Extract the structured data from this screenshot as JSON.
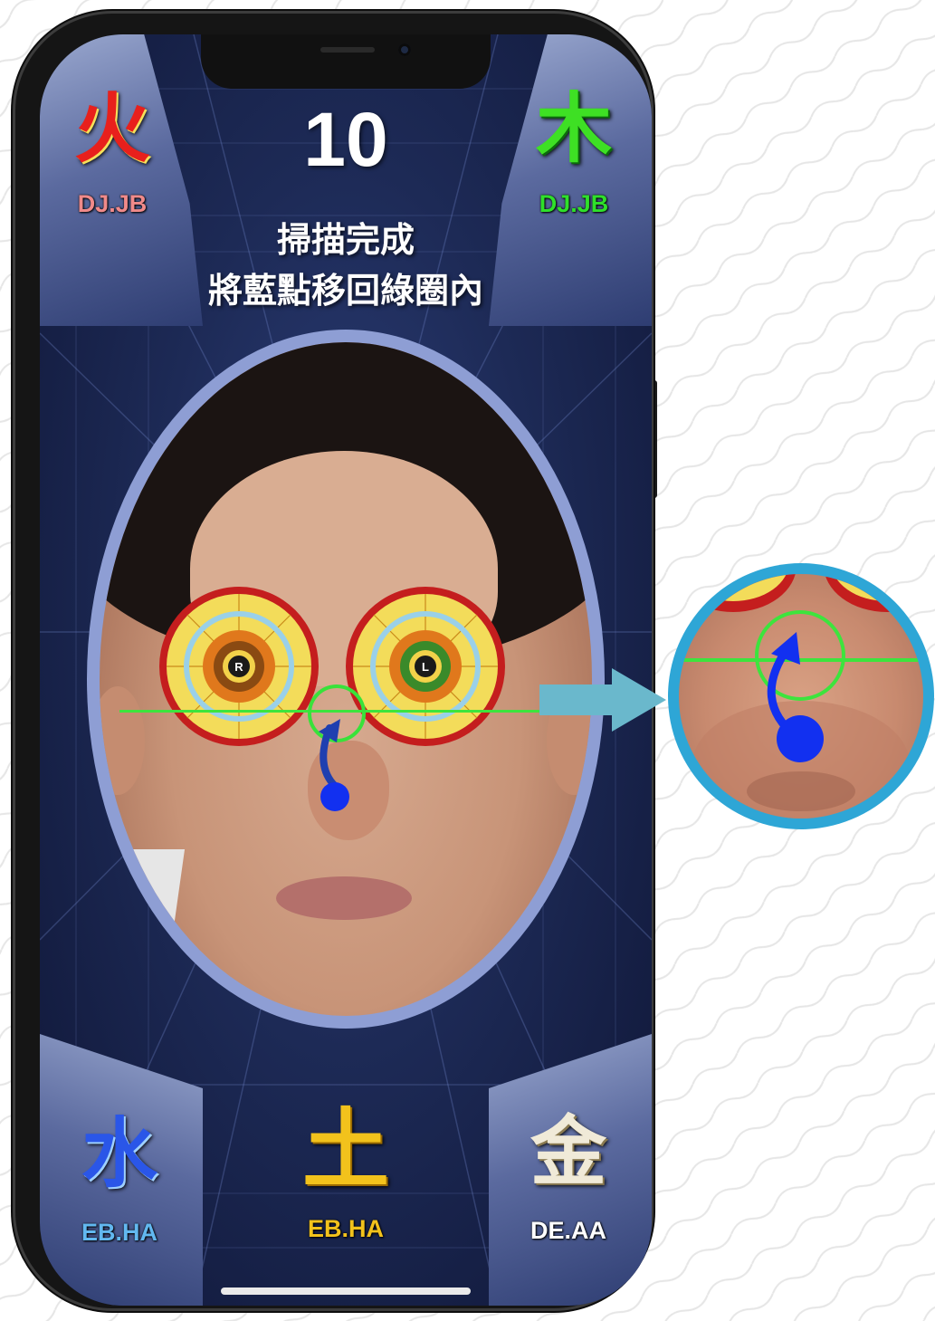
{
  "app": {
    "countdown": "10",
    "instruction_line1": "掃描完成",
    "instruction_line2": "將藍點移回綠圈內"
  },
  "elements": {
    "fire": {
      "char": "火",
      "code": "DJ.JB",
      "char_color": "#e8201c",
      "code_color": "#f08a8a"
    },
    "wood": {
      "char": "木",
      "code": "DJ.JB",
      "char_color": "#3ee024",
      "code_color": "#2fe02a"
    },
    "water": {
      "char": "水",
      "code": "EB.HA",
      "char_color": "#2a56e8",
      "code_color": "#62b8f0"
    },
    "earth": {
      "char": "土",
      "code": "EB.HA",
      "char_color": "#f2c21c",
      "code_color": "#f2c21c"
    },
    "metal": {
      "char": "金",
      "code": "DE.AA",
      "char_color": "#f0ead8",
      "code_color": "#ffffff"
    }
  },
  "iris_charts": {
    "right": {
      "label": "R"
    },
    "left": {
      "label": "L"
    }
  },
  "colors": {
    "guide_line": "#3de43d",
    "blue_dot": "#1230f0",
    "zoom_ring": "#2ea6d6",
    "arrow": "#6ab8cc"
  }
}
